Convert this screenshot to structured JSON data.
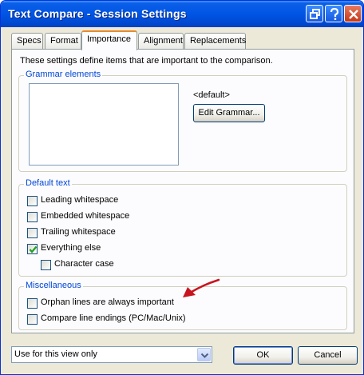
{
  "window": {
    "title": "Text Compare - Session Settings"
  },
  "tabs": [
    {
      "label": "Specs",
      "active": false
    },
    {
      "label": "Format",
      "active": false
    },
    {
      "label": "Importance",
      "active": true
    },
    {
      "label": "Alignment",
      "active": false
    },
    {
      "label": "Replacements",
      "active": false
    }
  ],
  "importance": {
    "intro": "These settings define items that are important to the comparison.",
    "grammar": {
      "legend": "Grammar elements",
      "current": "<default>",
      "edit_button": "Edit Grammar..."
    },
    "default_text": {
      "legend": "Default text",
      "options": [
        {
          "label": "Leading whitespace",
          "checked": false
        },
        {
          "label": "Embedded whitespace",
          "checked": false
        },
        {
          "label": "Trailing whitespace",
          "checked": false
        },
        {
          "label": "Everything else",
          "checked": true
        },
        {
          "label": "Character case",
          "checked": false
        }
      ]
    },
    "misc": {
      "legend": "Miscellaneous",
      "options": [
        {
          "label": "Orphan lines are always important",
          "checked": false
        },
        {
          "label": "Compare line endings (PC/Mac/Unix)",
          "checked": false
        }
      ]
    }
  },
  "footer": {
    "scope_value": "Use for this view only",
    "ok": "OK",
    "cancel": "Cancel"
  },
  "colors": {
    "titlebar": "#0055e5",
    "group_label": "#0046d5",
    "annotation_arrow": "#c8141e",
    "check_mark": "#21a121"
  }
}
